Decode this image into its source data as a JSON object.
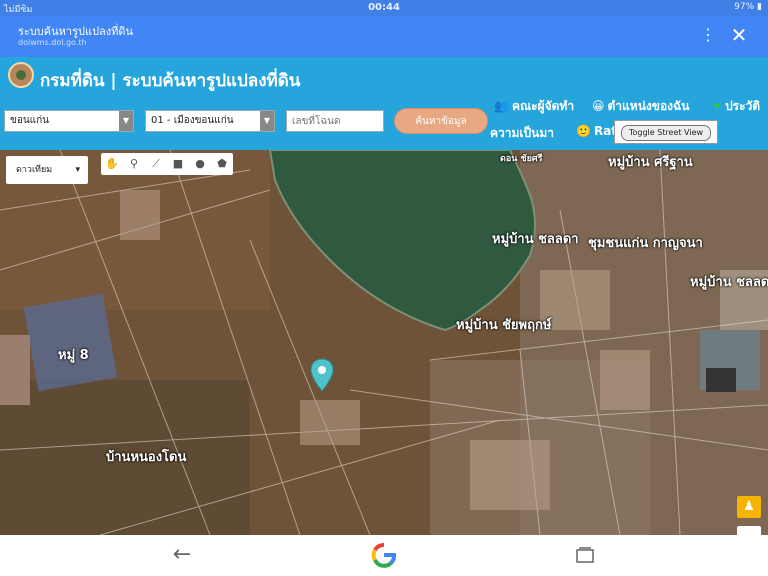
{
  "status_bar": {
    "carrier": "ไม่มีซิม",
    "time": "00:44",
    "battery": "97%"
  },
  "browser": {
    "page_title": "ระบบค้นหารูปแปลงที่ดิน",
    "url": "dolwms.dol.go.th"
  },
  "site": {
    "title": "กรมที่ดิน | ระบบค้นหารูปแปลงที่ดิน"
  },
  "search": {
    "province": "ขอนแก่น",
    "district": "01 - เมืองขอนแก่น",
    "parcel_placeholder": "เลขที่โฉนด",
    "search_button": "ค้นหาข้อมูล"
  },
  "nav": {
    "team": "คณะผู้จัดทำ",
    "my_location": "ตำแหน่งของฉัน",
    "history": "ประวัติ",
    "background": "ความเป็นมา",
    "rating": "Rat"
  },
  "street_view_button": "Toggle Street View",
  "map": {
    "type": "ดาวเทียม",
    "labels": [
      "หมู่บ้าน ศรีฐาน",
      "หมู่บ้าน ชลลดา",
      "ชุมชนแก่น กาญจนา",
      "หมู่บ้าน ชลลดา",
      "หมู่บ้าน ชัยพฤกษ์",
      "หมู่ 8",
      "บ้านหนองโดน",
      "ดอน ชัยศรี"
    ]
  },
  "colors": {
    "browser_bar": "#4285f4",
    "site_header": "#26a5dc",
    "search_button": "#e8a982"
  }
}
